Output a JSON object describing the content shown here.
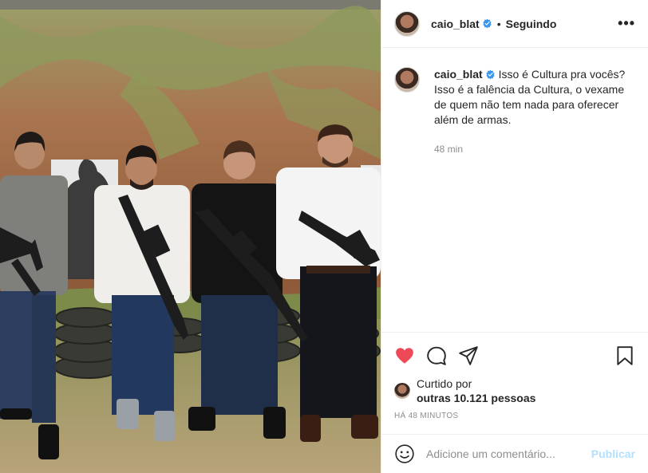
{
  "header": {
    "username": "caio_blat",
    "separator": "•",
    "follow_status": "Seguindo",
    "more_label": "•••"
  },
  "caption": {
    "username": "caio_blat",
    "text": "Isso é Cultura pra vocês? Isso é a falência da Cultura, o vexame de quem não tem nada para oferecer além de armas.",
    "time": "48 min"
  },
  "likes": {
    "prefix": "Curtido por",
    "count_text": "outras 10.121 pessoas"
  },
  "posted_time": "HÁ 48 MINUTOS",
  "comment": {
    "placeholder": "Adicione um comentário...",
    "publish_label": "Publicar"
  },
  "colors": {
    "like_red": "#ed4956",
    "verified_blue": "#3897f0",
    "publish_disabled": "#b2dffc"
  },
  "icons": [
    "verified-badge-icon",
    "heart-icon",
    "comment-icon",
    "share-icon",
    "bookmark-icon",
    "emoji-icon"
  ]
}
